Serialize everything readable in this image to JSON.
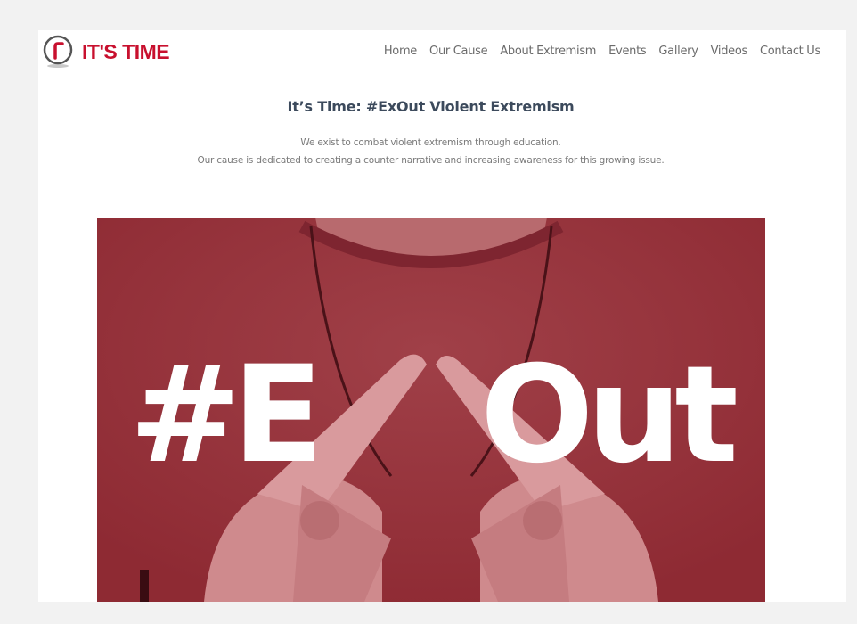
{
  "brand": {
    "name": "IT'S TIME",
    "accent_color": "#c8102e",
    "logo_icon": "clock-icon"
  },
  "nav": {
    "items": [
      {
        "label": "Home"
      },
      {
        "label": "Our Cause"
      },
      {
        "label": "About Extremism"
      },
      {
        "label": "Events"
      },
      {
        "label": "Gallery"
      },
      {
        "label": "Videos"
      },
      {
        "label": "Contact Us"
      }
    ]
  },
  "intro": {
    "title": "It’s Time: #ExOut Violent Extremism",
    "line1": "We exist to combat violent extremism through education.",
    "line2": "Our cause is dedicated to creating a counter narrative and increasing awareness for this growing issue."
  },
  "hero": {
    "text_left": "#E",
    "text_right": "Out",
    "tint_color": "#a8323a"
  }
}
